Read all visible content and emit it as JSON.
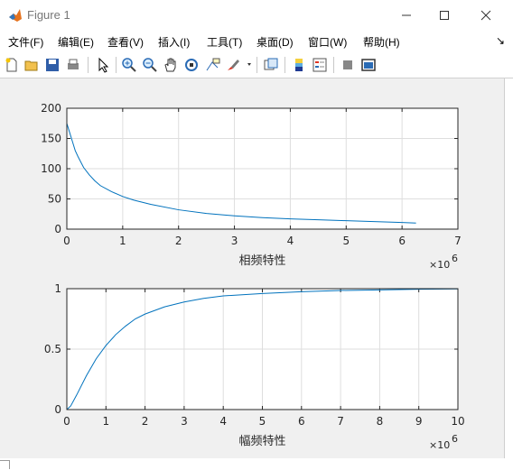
{
  "window": {
    "title": "Figure 1",
    "icon": "matlab-logo-icon",
    "controls": [
      "minimize-icon",
      "maximize-icon",
      "close-icon"
    ]
  },
  "menu": {
    "items": [
      "文件(F)",
      "编辑(E)",
      "查看(V)",
      "插入(I)",
      "工具(T)",
      "桌面(D)",
      "窗口(W)",
      "帮助(H)"
    ],
    "overflow_arrow": "↘"
  },
  "toolbar": {
    "icons": [
      "new-figure-icon",
      "open-file-icon",
      "save-icon",
      "print-icon",
      "pointer-icon",
      "zoom-in-icon",
      "zoom-out-icon",
      "pan-hand-icon",
      "rotate-3d-icon",
      "data-cursor-icon",
      "brush-icon",
      "link-plot-icon",
      "colorbar-icon",
      "legend-icon",
      "hide-plot-tools-icon",
      "show-plot-tools-icon"
    ]
  },
  "colors": {
    "line": "#0072bd",
    "grid": "#dedede",
    "axes_bg": "#ffffff",
    "figure_bg": "#f0f0f0"
  },
  "chart_data": [
    {
      "type": "line",
      "xlabel": "相频特性",
      "x_exponent": "×10",
      "x_exponent_power": "6",
      "xlim": [
        0,
        7
      ],
      "ylim": [
        0,
        200
      ],
      "xticks": [
        "0",
        "1",
        "2",
        "3",
        "4",
        "5",
        "6",
        "7"
      ],
      "yticks": [
        "0",
        "50",
        "100",
        "150",
        "200"
      ],
      "grid": true,
      "series": [
        {
          "x": [
            0,
            0.05,
            0.1,
            0.15,
            0.2,
            0.3,
            0.4,
            0.5,
            0.6,
            0.8,
            1.0,
            1.2,
            1.5,
            2.0,
            2.5,
            3.0,
            3.5,
            4.0,
            4.5,
            5.0,
            5.5,
            6.0,
            6.25
          ],
          "y": [
            175,
            160,
            145,
            130,
            120,
            102,
            90,
            80,
            72,
            62,
            54,
            48,
            41,
            32,
            26,
            22,
            19,
            17,
            15.5,
            14,
            12.5,
            11,
            10
          ]
        }
      ]
    },
    {
      "type": "line",
      "xlabel": "幅频特性",
      "x_exponent": "×10",
      "x_exponent_power": "6",
      "xlim": [
        0,
        10
      ],
      "ylim": [
        0,
        1
      ],
      "xticks": [
        "0",
        "1",
        "2",
        "3",
        "4",
        "5",
        "6",
        "7",
        "8",
        "9",
        "10"
      ],
      "yticks": [
        "0",
        "0.5",
        "1"
      ],
      "grid": true,
      "series": [
        {
          "x": [
            0,
            0.1,
            0.25,
            0.5,
            0.75,
            1.0,
            1.25,
            1.5,
            1.75,
            2.0,
            2.5,
            3.0,
            3.5,
            4.0,
            5.0,
            6.0,
            7.0,
            8.0,
            9.0,
            10.0
          ],
          "y": [
            0,
            0.03,
            0.12,
            0.28,
            0.42,
            0.53,
            0.62,
            0.69,
            0.75,
            0.79,
            0.85,
            0.89,
            0.92,
            0.94,
            0.96,
            0.975,
            0.985,
            0.99,
            0.995,
            0.998
          ]
        }
      ]
    }
  ]
}
